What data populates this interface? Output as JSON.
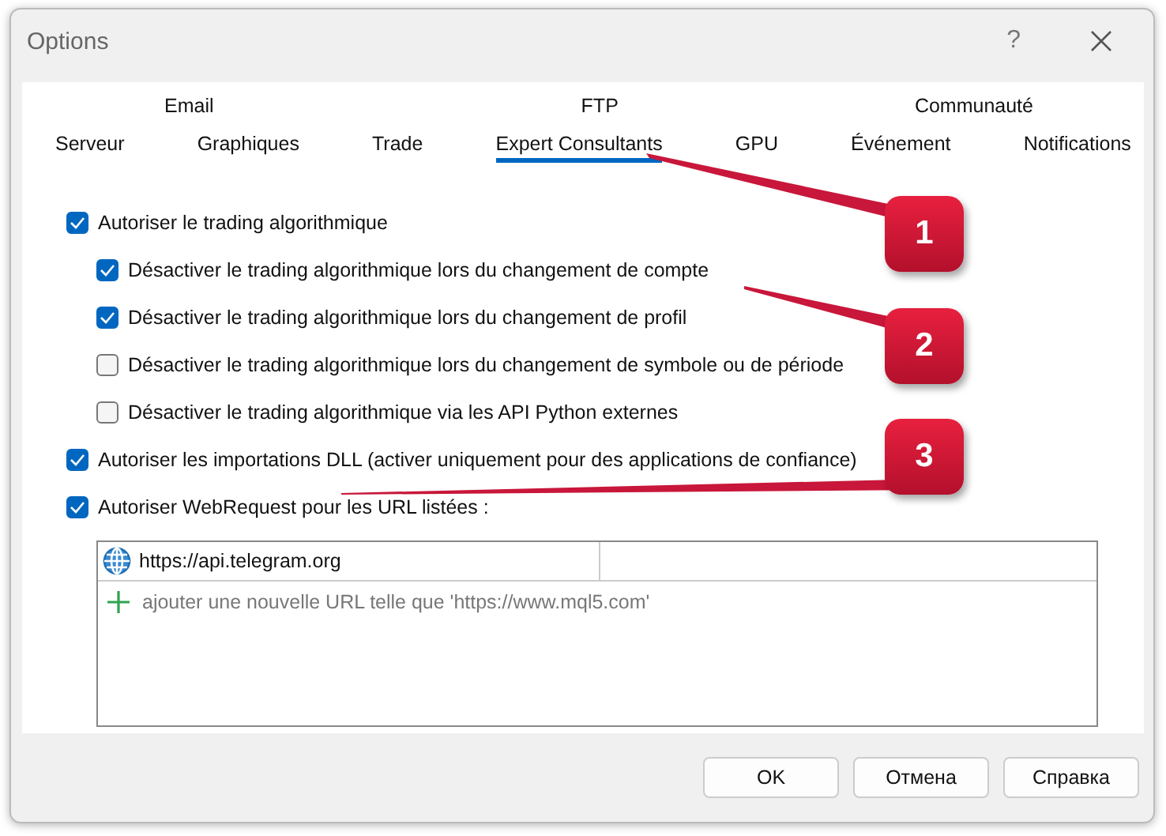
{
  "window": {
    "title": "Options",
    "help": "?"
  },
  "tab_rows": [
    [
      {
        "label": "Email",
        "selected": false
      },
      {
        "label": "FTP",
        "selected": false
      },
      {
        "label": "Communauté",
        "selected": false
      }
    ],
    [
      {
        "label": "Serveur",
        "selected": false
      },
      {
        "label": "Graphiques",
        "selected": false
      },
      {
        "label": "Trade",
        "selected": false
      },
      {
        "label": "Expert Consultants",
        "selected": true
      },
      {
        "label": "GPU",
        "selected": false
      },
      {
        "label": "Événement",
        "selected": false
      },
      {
        "label": "Notifications",
        "selected": false
      }
    ]
  ],
  "options": [
    {
      "label": "Autoriser le trading algorithmique",
      "checked": true,
      "children": [
        {
          "label": "Désactiver le trading algorithmique lors du changement de compte",
          "checked": true
        },
        {
          "label": "Désactiver le trading algorithmique lors du changement de profil",
          "checked": true
        },
        {
          "label": "Désactiver le trading algorithmique lors du changement de symbole ou de période",
          "checked": false
        },
        {
          "label": "Désactiver le trading algorithmique via les API Python externes",
          "checked": false
        }
      ]
    },
    {
      "label": "Autoriser les importations DLL (activer uniquement pour des applications de confiance)",
      "checked": true
    },
    {
      "label": "Autoriser WebRequest pour les URL listées :",
      "checked": true
    }
  ],
  "url_list": {
    "rows": [
      {
        "url": "https://api.telegram.org"
      }
    ],
    "placeholder": "ajouter une nouvelle URL telle que 'https://www.mql5.com'"
  },
  "buttons": [
    "OK",
    "Отмена",
    "Справка"
  ],
  "callouts": [
    "1",
    "2",
    "3"
  ]
}
